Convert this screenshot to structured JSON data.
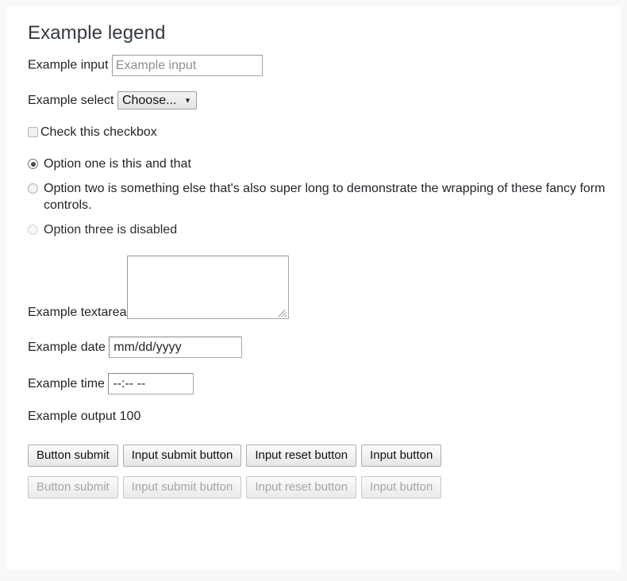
{
  "form": {
    "legend": "Example legend",
    "input_field": {
      "label": "Example input",
      "placeholder": "Example input",
      "value": ""
    },
    "select_field": {
      "label": "Example select",
      "selected": "Choose...",
      "arrow_icon": "▼"
    },
    "checkbox_field": {
      "label": "Check this checkbox",
      "checked": false
    },
    "radio_group": {
      "options": [
        {
          "label": "Option one is this and that",
          "checked": true,
          "disabled": false
        },
        {
          "label": "Option two is something else that's also super long to demonstrate the wrapping of these fancy form controls.",
          "checked": false,
          "disabled": false
        },
        {
          "label": "Option three is disabled",
          "checked": false,
          "disabled": true
        }
      ]
    },
    "textarea_field": {
      "label": "Example textarea",
      "value": ""
    },
    "date_field": {
      "label": "Example date",
      "placeholder": "mm/dd/yyyy",
      "value": "mm/dd/yyyy"
    },
    "time_field": {
      "label": "Example time",
      "placeholder": "--:-- --",
      "value": "--:-- --"
    },
    "output_field": {
      "label": "Example output",
      "value": "100"
    },
    "buttons_enabled": [
      "Button submit",
      "Input submit button",
      "Input reset button",
      "Input button"
    ],
    "buttons_disabled": [
      "Button submit",
      "Input submit button",
      "Input reset button",
      "Input button"
    ]
  }
}
